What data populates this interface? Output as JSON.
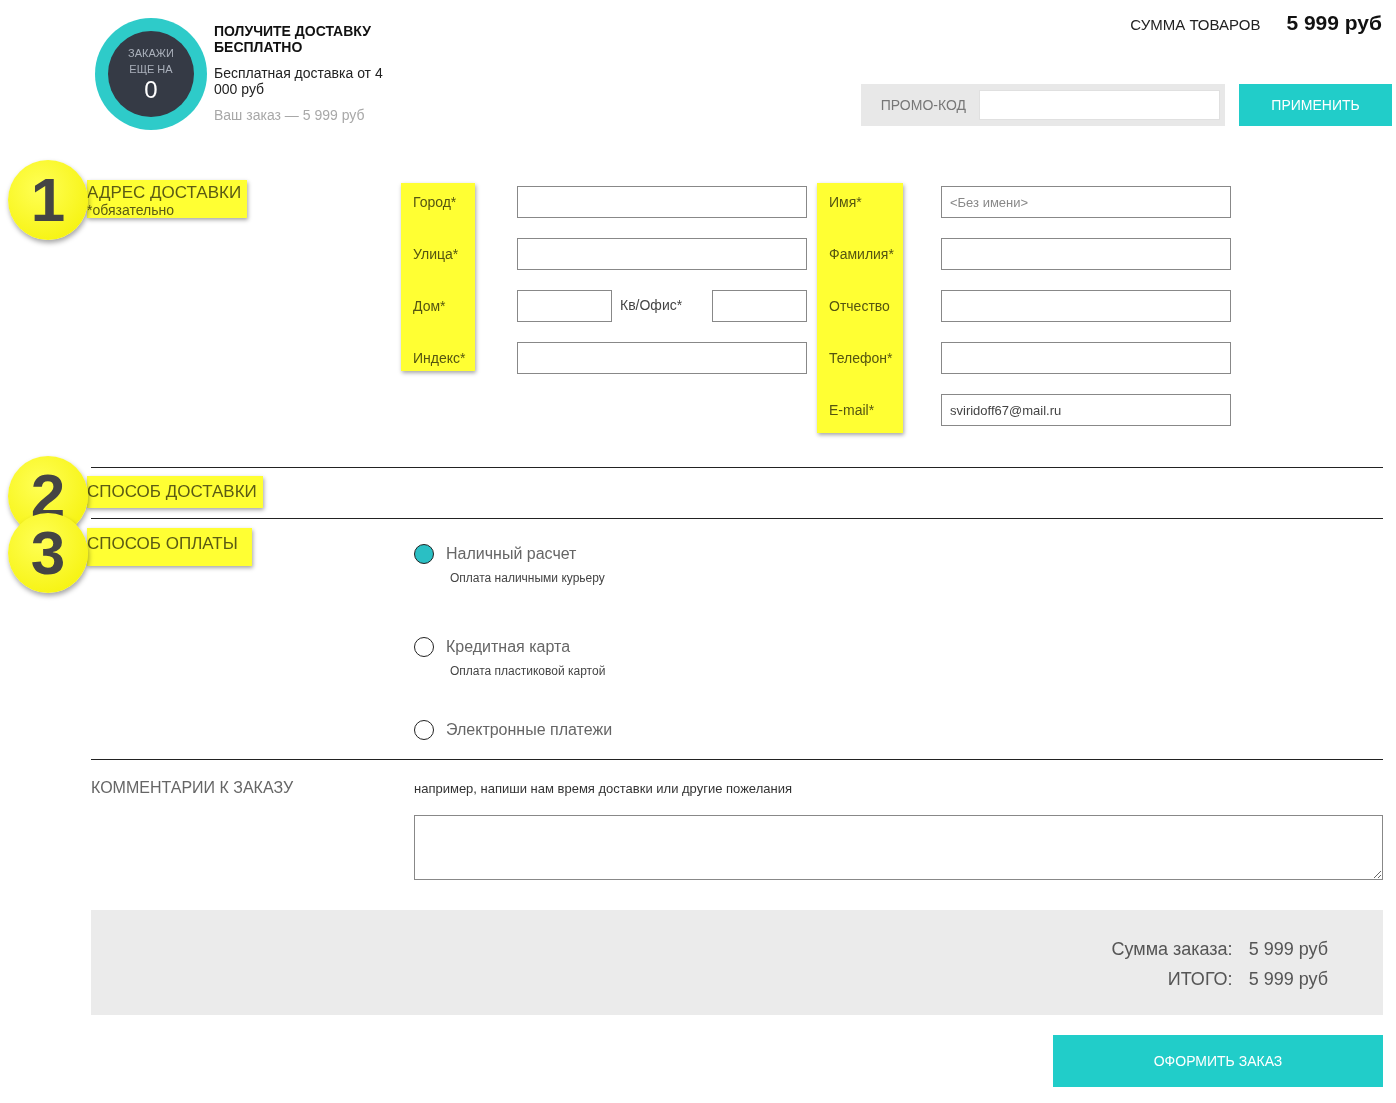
{
  "promo_banner": {
    "circle_text": "ЗАКАЖИ ЕЩЕ НА",
    "circle_amount": "0",
    "title": "ПОЛУЧИТЕ ДОСТАВКУ БЕСПЛАТНО",
    "subtitle": "Бесплатная доставка от 4 000 руб",
    "order_note": "Ваш заказ — 5 999 руб"
  },
  "cart_total": {
    "label": "СУММА ТОВАРОВ",
    "value": "5 999 руб"
  },
  "promo_code": {
    "label": "ПРОМО-КОД",
    "button": "ПРИМЕНИТЬ"
  },
  "steps": [
    {
      "number": "1",
      "title": "АДРЕС ДОСТАВКИ",
      "note": "*обязательно"
    },
    {
      "number": "2",
      "title": "СПОСОБ ДОСТАВКИ"
    },
    {
      "number": "3",
      "title": "СПОСОБ ОПЛАТЫ"
    }
  ],
  "address_fields": [
    {
      "kind": "single",
      "label": "Город*"
    },
    {
      "kind": "single",
      "label": "Улица*"
    },
    {
      "kind": "pair",
      "label": "Дом*",
      "second_label": "Кв/Офис*"
    },
    {
      "kind": "single",
      "label": "Индекс*"
    }
  ],
  "contact_fields": [
    {
      "label": "Имя*",
      "placeholder": "<Без имени>"
    },
    {
      "label": "Фамилия*"
    },
    {
      "label": "Отчество"
    },
    {
      "label": "Телефон*"
    },
    {
      "label": "E-mail*",
      "value": "sviridoff67@mail.ru"
    }
  ],
  "payment_options": [
    {
      "label": "Наличный расчет",
      "description": "Оплата наличными курьеру",
      "selected": true
    },
    {
      "label": "Кредитная карта",
      "description": "Оплата пластиковой картой",
      "selected": false
    },
    {
      "label": "Электронные платежи",
      "selected": false
    }
  ],
  "comment": {
    "label": "КОММЕНТАРИИ К ЗАКАЗУ",
    "hint": "например, напиши нам время доставки или другие пожелания"
  },
  "summary": [
    {
      "label": "Сумма заказа:",
      "value": "5 999 руб"
    },
    {
      "label": "ИТОГО:",
      "value": "5 999 руб"
    }
  ],
  "submit_button": "ОФОРМИТЬ ЗАКАЗ"
}
